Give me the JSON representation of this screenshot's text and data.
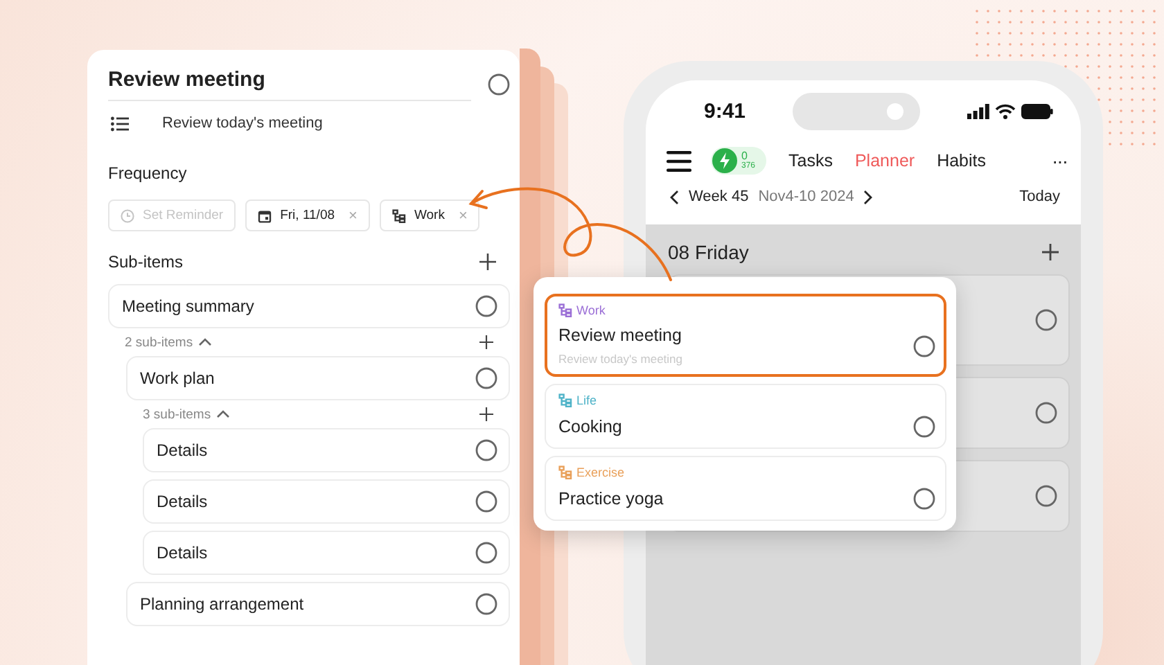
{
  "detail_panel": {
    "title": "Review meeting",
    "checked": false,
    "note": "Review today's meeting",
    "frequency_label": "Frequency",
    "chips": [
      {
        "kind": "reminder",
        "label": "Set Reminder",
        "disabled": true
      },
      {
        "kind": "date",
        "label": "Fri, 11/08",
        "disabled": false,
        "remove": "×"
      },
      {
        "kind": "category",
        "label": "Work",
        "disabled": false,
        "remove": "×"
      }
    ],
    "sub_items_label": "Sub-items",
    "sub_items": [
      {
        "title": "Meeting summary",
        "checked": false,
        "expanded": true,
        "count": "2 sub-items",
        "children": [
          {
            "title": "Work plan",
            "checked": false,
            "expanded": true,
            "count": "3 sub-items",
            "children": [
              {
                "title": "Details",
                "checked": false
              },
              {
                "title": "Details",
                "checked": false
              },
              {
                "title": "Details",
                "checked": false
              }
            ]
          },
          {
            "title": "Planning arrangement",
            "checked": false
          }
        ]
      }
    ]
  },
  "phone": {
    "time": "9:41",
    "energy": {
      "value": "0",
      "total": "376"
    },
    "tabs": [
      {
        "label": "Tasks",
        "selected": false
      },
      {
        "label": "Planner",
        "selected": true
      },
      {
        "label": "Habits",
        "selected": false
      }
    ],
    "more": "···",
    "week": {
      "label": "Week 45",
      "range": "Nov4-10 2024",
      "today": "Today"
    },
    "day": {
      "title": "08 Friday"
    },
    "background_cards": [
      {
        "checked": false
      },
      {
        "checked": false
      },
      {
        "checked": false
      }
    ]
  },
  "popup": {
    "tasks": [
      {
        "tag": "Work",
        "color": "#9b6fd6",
        "title": "Review meeting",
        "subtitle": "Review today's meeting",
        "checked": false,
        "selected": true
      },
      {
        "tag": "Life",
        "color": "#4fb3c8",
        "title": "Cooking",
        "checked": false,
        "selected": false
      },
      {
        "tag": "Exercise",
        "color": "#e9a05a",
        "title": "Practice yoga",
        "checked": false,
        "selected": false
      }
    ]
  }
}
